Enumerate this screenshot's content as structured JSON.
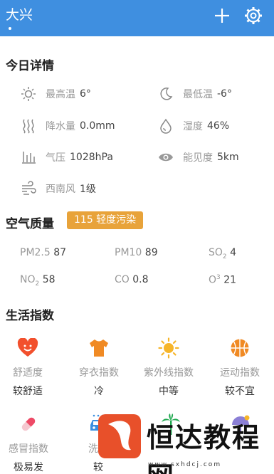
{
  "header": {
    "city": "大兴"
  },
  "sections": {
    "today": "今日详情",
    "air": "空气质量",
    "life": "生活指数"
  },
  "details": [
    {
      "icon": "sun-icon",
      "label": "最高温",
      "value": "6°"
    },
    {
      "icon": "moon-icon",
      "label": "最低温",
      "value": "-6°"
    },
    {
      "icon": "rain-icon",
      "label": "降水量",
      "value": "0.0mm"
    },
    {
      "icon": "humidity-icon",
      "label": "湿度",
      "value": "46%"
    },
    {
      "icon": "pressure-icon",
      "label": "气压",
      "value": "1028hPa"
    },
    {
      "icon": "eye-icon",
      "label": "能见度",
      "value": "5km"
    },
    {
      "icon": "wind-icon",
      "label": "西南风",
      "value": "1级"
    }
  ],
  "aqi": {
    "badge": "115 轻度污染",
    "badge_color": "#e8a33a",
    "items": {
      "pm25_label": "PM2.5",
      "pm25_value": "87",
      "pm10_label": "PM10",
      "pm10_value": "89",
      "so2_label": "SO",
      "so2_sub": "2",
      "so2_value": "4",
      "no2_label": "NO",
      "no2_sub": "2",
      "no2_value": "58",
      "co_label": "CO",
      "co_value": "0.8",
      "o3_label": "O",
      "o3_sup": "3",
      "o3_value": "21"
    }
  },
  "indices": [
    {
      "icon": "heart-icon",
      "name": "舒适度",
      "value": "较舒适"
    },
    {
      "icon": "shirt-icon",
      "name": "穿衣指数",
      "value": "冷"
    },
    {
      "icon": "sun-uv-icon",
      "name": "紫外线指数",
      "value": "中等"
    },
    {
      "icon": "basketball-icon",
      "name": "运动指数",
      "value": "较不宜"
    },
    {
      "icon": "pill-icon",
      "name": "感冒指数",
      "value": "极易发"
    },
    {
      "icon": "car-icon",
      "name": "洗车",
      "value": "较"
    },
    {
      "icon": "palm-icon",
      "name": "",
      "value": ""
    },
    {
      "icon": "umbrella-icon",
      "name": "",
      "value": ""
    }
  ],
  "watermark": {
    "text": "恒达教程网",
    "url": "www.sxhdcj.com"
  },
  "colors": {
    "header": "#3f8fe0",
    "accent_orange": "#f08a24"
  }
}
